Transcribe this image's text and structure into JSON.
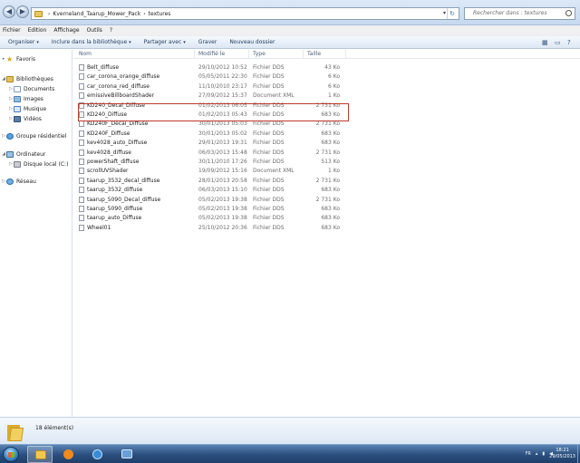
{
  "address": {
    "crumbs": [
      "Kverneland_Taarup_Mower_Pack",
      "textures"
    ],
    "search_placeholder": "Rechercher dans : textures"
  },
  "menu": [
    "Fichier",
    "Edition",
    "Affichage",
    "Outils",
    "?"
  ],
  "toolbar": {
    "organize": "Organiser",
    "include": "Inclure dans la bibliothèque",
    "share": "Partager avec",
    "burn": "Graver",
    "new_folder": "Nouveau dossier"
  },
  "nav": {
    "favorites": "Favoris",
    "libraries": "Bibliothèques",
    "documents": "Documents",
    "images": "Images",
    "music": "Musique",
    "videos": "Vidéos",
    "homegroup": "Groupe résidentiel",
    "computer": "Ordinateur",
    "local_disk": "Disque local (C:)",
    "network": "Réseau"
  },
  "columns": {
    "name": "Nom",
    "date": "Modifié le",
    "type": "Type",
    "size": "Taille"
  },
  "files": [
    {
      "name": "Belt_diffuse",
      "date": "29/10/2012 10:52",
      "type": "Fichier DDS",
      "size": "43 Ko"
    },
    {
      "name": "car_corona_orange_diffuse",
      "date": "05/05/2011 22:30",
      "type": "Fichier DDS",
      "size": "6 Ko"
    },
    {
      "name": "car_corona_red_diffuse",
      "date": "11/10/2010 23:17",
      "type": "Fichier DDS",
      "size": "6 Ko"
    },
    {
      "name": "emissiveBillboardShader",
      "date": "27/09/2012 15:37",
      "type": "Document XML",
      "size": "1 Ko"
    },
    {
      "name": "KD240_Decal_Diffuse",
      "date": "01/02/2013 06:05",
      "type": "Fichier DDS",
      "size": "2 731 Ko"
    },
    {
      "name": "KD240_Diffuse",
      "date": "01/02/2013 05:43",
      "type": "Fichier DDS",
      "size": "683 Ko"
    },
    {
      "name": "KD240F_Decal_Diffuse",
      "date": "30/01/2013 05:03",
      "type": "Fichier DDS",
      "size": "2 731 Ko"
    },
    {
      "name": "KD240F_Diffuse",
      "date": "30/01/2013 05:02",
      "type": "Fichier DDS",
      "size": "683 Ko"
    },
    {
      "name": "kev4028_auto_Diffuse",
      "date": "29/01/2013 19:31",
      "type": "Fichier DDS",
      "size": "683 Ko"
    },
    {
      "name": "kev4028_diffuse",
      "date": "06/03/2013 15:48",
      "type": "Fichier DDS",
      "size": "2 731 Ko"
    },
    {
      "name": "powerShaft_diffuse",
      "date": "30/11/2010 17:26",
      "type": "Fichier DDS",
      "size": "513 Ko"
    },
    {
      "name": "scrollUVShader",
      "date": "19/09/2012 15:16",
      "type": "Document XML",
      "size": "1 Ko"
    },
    {
      "name": "taarup_3532_decal_diffuse",
      "date": "28/01/2013 20:58",
      "type": "Fichier DDS",
      "size": "2 731 Ko"
    },
    {
      "name": "taarup_3532_diffuse",
      "date": "06/03/2013 15:10",
      "type": "Fichier DDS",
      "size": "683 Ko"
    },
    {
      "name": "taarup_5090_Decal_diffuse",
      "date": "05/02/2013 19:38",
      "type": "Fichier DDS",
      "size": "2 731 Ko"
    },
    {
      "name": "taarup_5090_diffuse",
      "date": "05/02/2013 19:38",
      "type": "Fichier DDS",
      "size": "683 Ko"
    },
    {
      "name": "taarup_auto_Diffuse",
      "date": "05/02/2013 19:38",
      "type": "Fichier DDS",
      "size": "683 Ko"
    },
    {
      "name": "Wheel01",
      "date": "25/10/2012 20:36",
      "type": "Fichier DDS",
      "size": "683 Ko"
    }
  ],
  "details": {
    "count": "18 élément(s)"
  },
  "taskbar": {
    "lang": "FR",
    "time": "18:21",
    "date": "29/05/2013"
  }
}
